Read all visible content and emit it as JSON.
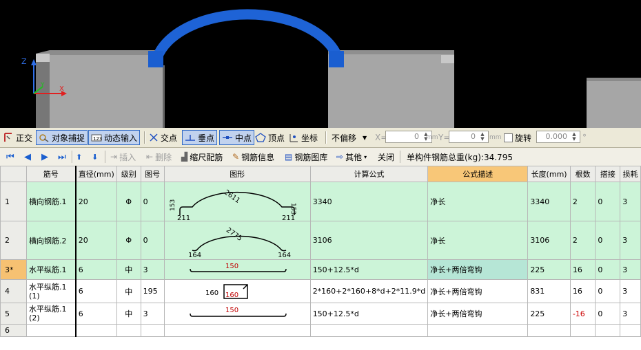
{
  "axis": {
    "z": "Z",
    "y": "Y",
    "x": "X"
  },
  "snap_toolbar": {
    "ortho": "正交",
    "object_snap": "对象捕捉",
    "dynamic_input": "动态输入",
    "intersection": "交点",
    "perpendicular": "垂点",
    "midpoint": "中点",
    "vertex": "顶点",
    "coordinate": "坐标",
    "offset_mode": "不偏移",
    "x_label": "X=",
    "x_value": "0",
    "x_unit": "mm",
    "y_label": "Y=",
    "y_value": "0",
    "y_unit": "mm",
    "rotate": "旋转",
    "rotate_value": "0.000",
    "rotate_unit": "°"
  },
  "rebar_toolbar": {
    "insert": "插入",
    "delete": "删除",
    "scale_rebar": "缩尺配筋",
    "rebar_info": "钢筋信息",
    "rebar_library": "钢筋图库",
    "other": "其他",
    "close": "关闭",
    "total_weight": "单构件钢筋总重(kg):34.795"
  },
  "table": {
    "headers": [
      "",
      "筋号",
      "直径(mm)",
      "级别",
      "图号",
      "图形",
      "计算公式",
      "公式描述",
      "长度(mm)",
      "根数",
      "搭接",
      "损耗"
    ],
    "rows": [
      {
        "idx": "1",
        "name": "横向钢筋.1",
        "dia": "20",
        "grade": "Φ",
        "fig": "0",
        "formula": "3340",
        "desc": "净长",
        "length": "3340",
        "count": "2",
        "lap": "0",
        "loss": "3",
        "shape": {
          "arc": "2611",
          "left_hook": "153",
          "right_hook": "153",
          "left_base": "211",
          "right_base": "211"
        }
      },
      {
        "idx": "2",
        "name": "横向钢筋.2",
        "dia": "20",
        "grade": "Φ",
        "fig": "0",
        "formula": "3106",
        "desc": "净长",
        "length": "3106",
        "count": "2",
        "lap": "0",
        "loss": "3",
        "shape": {
          "arc": "2775",
          "left_base": "164",
          "right_base": "164"
        }
      },
      {
        "idx": "3*",
        "name": "水平纵筋.1",
        "dia": "6",
        "grade": "中",
        "fig": "3",
        "formula": "150+12.5*d",
        "desc": "净长+两倍弯钩",
        "length": "225",
        "count": "16",
        "lap": "0",
        "loss": "3",
        "shape": {
          "straight": "150"
        }
      },
      {
        "idx": "4",
        "name": "水平纵筋.1(1)",
        "dia": "6",
        "grade": "中",
        "fig": "195",
        "formula": "2*160+2*160+8*d+2*11.9*d",
        "desc": "净长+两倍弯钩",
        "length": "831",
        "count": "16",
        "lap": "0",
        "loss": "3",
        "shape": {
          "box_left": "160",
          "box_inner": "160"
        }
      },
      {
        "idx": "5",
        "name": "水平纵筋.1(2)",
        "dia": "6",
        "grade": "中",
        "fig": "3",
        "formula": "150+12.5*d",
        "desc": "净长+两倍弯钩",
        "length": "225",
        "count": "-16",
        "lap": "0",
        "loss": "3",
        "shape": {
          "straight": "150"
        }
      },
      {
        "idx": "6",
        "name": "",
        "dia": "",
        "grade": "",
        "fig": "",
        "formula": "",
        "desc": "",
        "length": "",
        "count": "",
        "lap": "",
        "loss": ""
      }
    ]
  }
}
